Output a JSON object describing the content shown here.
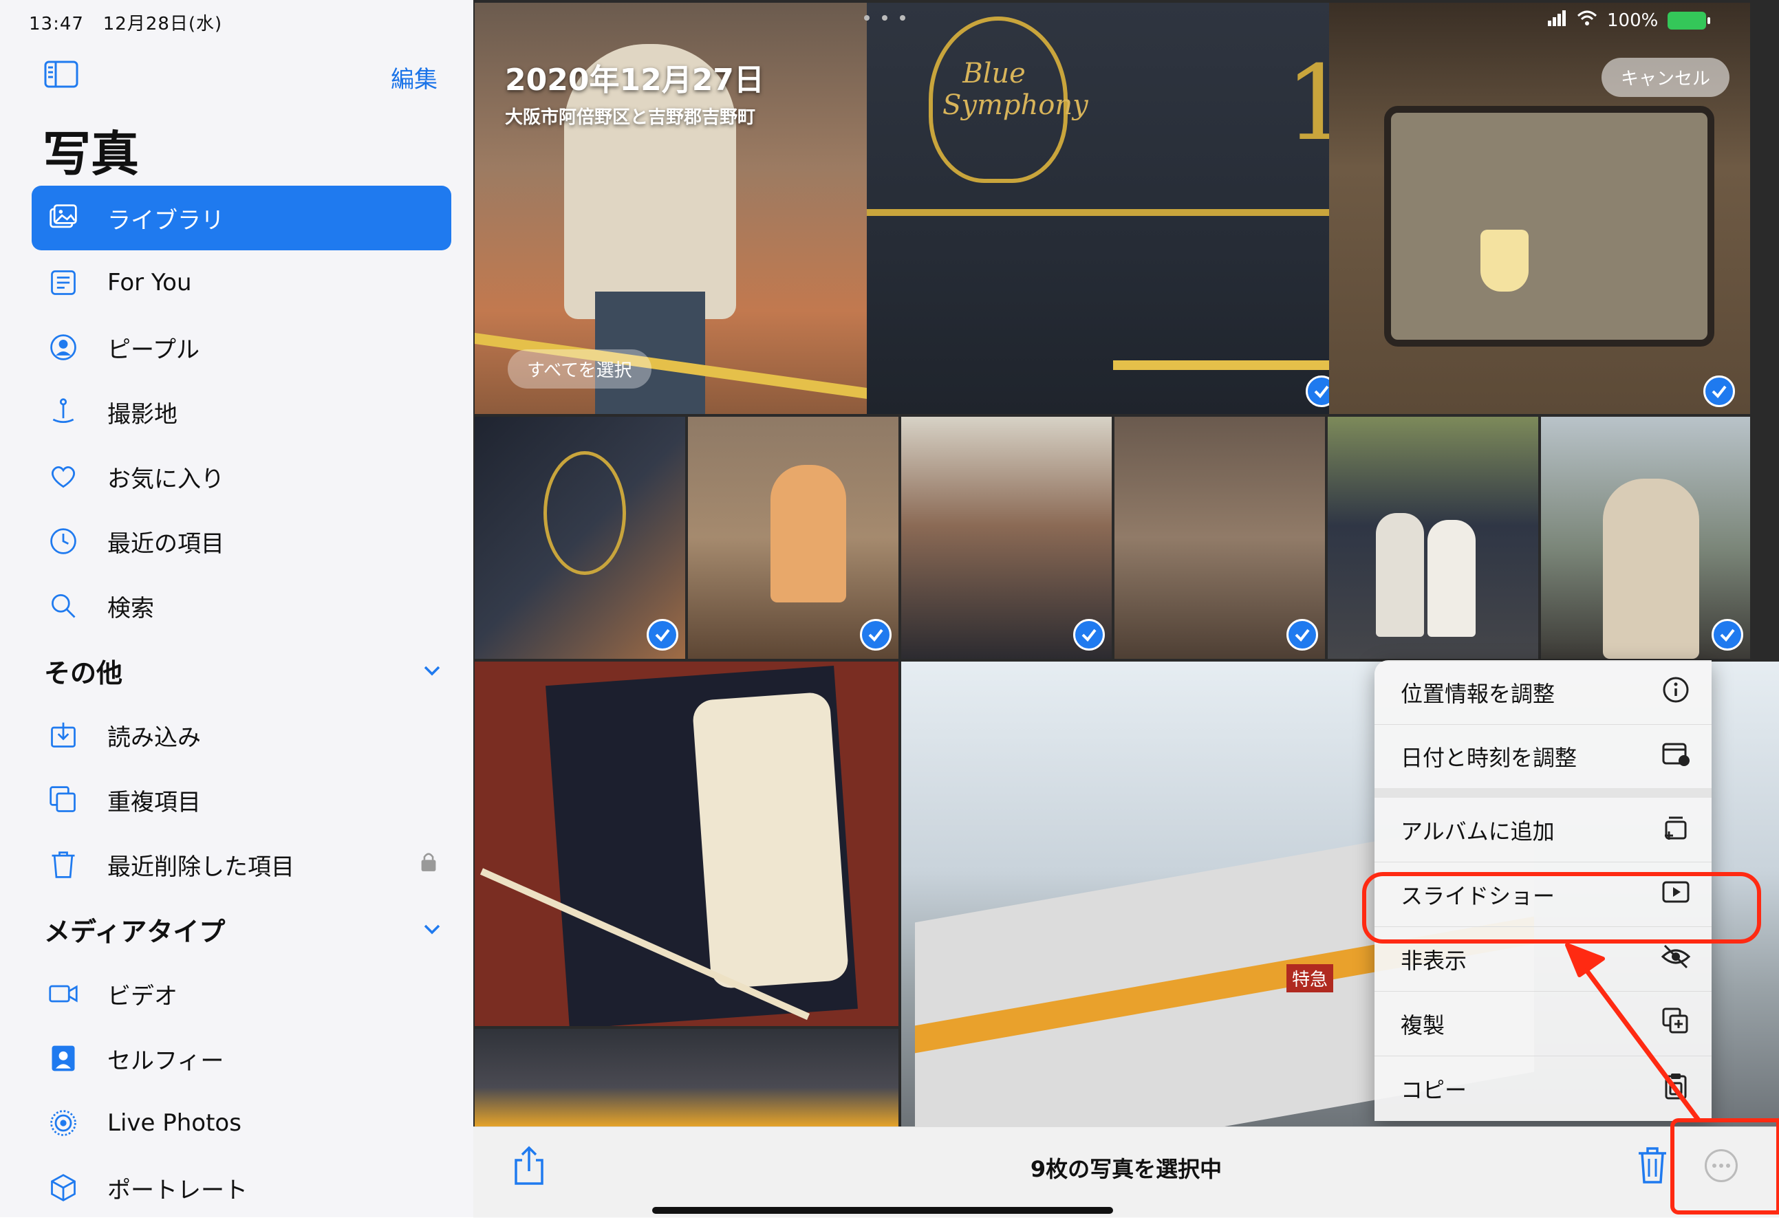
{
  "status_bar": {
    "time": "13:47",
    "date": "12月28日(水)",
    "battery": "100%"
  },
  "sidebar": {
    "edit_label": "編集",
    "title": "写真",
    "items": [
      {
        "label": "ライブラリ",
        "icon": "library-icon",
        "active": true
      },
      {
        "label": "For You",
        "icon": "for-you-icon"
      },
      {
        "label": "ピープル",
        "icon": "people-icon"
      },
      {
        "label": "撮影地",
        "icon": "places-icon"
      },
      {
        "label": "お気に入り",
        "icon": "heart-icon"
      },
      {
        "label": "最近の項目",
        "icon": "clock-icon"
      },
      {
        "label": "検索",
        "icon": "search-icon"
      }
    ],
    "sections": [
      {
        "label": "その他",
        "items": [
          {
            "label": "読み込み",
            "icon": "import-icon"
          },
          {
            "label": "重複項目",
            "icon": "duplicates-icon"
          },
          {
            "label": "最近削除した項目",
            "icon": "trash-icon",
            "locked": true
          }
        ]
      },
      {
        "label": "メディアタイプ",
        "items": [
          {
            "label": "ビデオ",
            "icon": "video-icon"
          },
          {
            "label": "セルフィー",
            "icon": "selfie-icon"
          },
          {
            "label": "Live Photos",
            "icon": "live-photos-icon"
          },
          {
            "label": "ポートレート",
            "icon": "portrait-icon"
          }
        ]
      }
    ]
  },
  "grid": {
    "date_title": "2020年12月27日",
    "location": "大阪市阿倍野区と吉野郡吉野町",
    "select_all_label": "すべてを選択",
    "cancel_label": "キャンセル",
    "train_text": "Blue Symphony",
    "car_number": "1",
    "sign_text": "特急"
  },
  "context_menu": {
    "items": [
      {
        "label": "位置情報を調整",
        "icon": "info-icon"
      },
      {
        "label": "日付と時刻を調整",
        "icon": "calendar-icon"
      },
      {
        "label": "アルバムに追加",
        "icon": "add-album-icon"
      },
      {
        "label": "スライドショー",
        "icon": "play-icon"
      },
      {
        "label": "非表示",
        "icon": "eye-slash-icon"
      },
      {
        "label": "複製",
        "icon": "duplicate-icon"
      },
      {
        "label": "コピー",
        "icon": "copy-icon"
      }
    ]
  },
  "toolbar": {
    "status": "9枚の写真を選択中"
  },
  "colors": {
    "accent": "#1f7aef",
    "sidebar_bg": "#f5f5f8",
    "annotation": "#ff2a12"
  }
}
